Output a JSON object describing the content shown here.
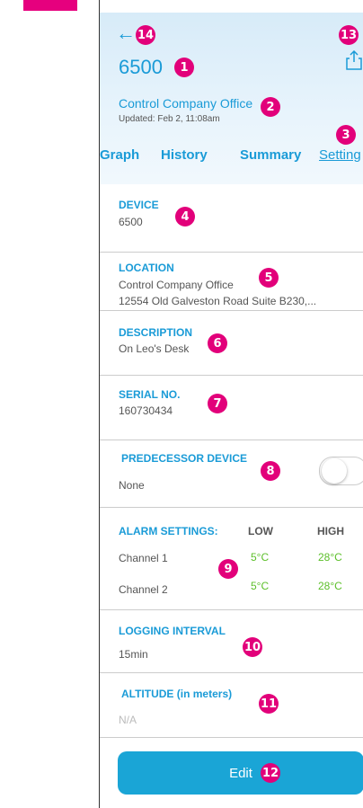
{
  "header": {
    "back_icon": "←",
    "share_icon": "share-icon",
    "device_title": "6500",
    "location_link": "Control Company Office",
    "updated": "Updated: Feb 2, 11:08am"
  },
  "tabs": [
    {
      "label": "Graph"
    },
    {
      "label": "History"
    },
    {
      "label": "Summary"
    },
    {
      "label": "Setting"
    }
  ],
  "device": {
    "label": "DEVICE",
    "value": "6500"
  },
  "location": {
    "label": "LOCATION",
    "line1": "Control Company Office",
    "line2": "12554 Old Galveston Road Suite B230,..."
  },
  "description": {
    "label": "DESCRIPTION",
    "value": "On Leo's Desk"
  },
  "serial": {
    "label": "SERIAL NO.",
    "value": "160730434"
  },
  "predecessor": {
    "label": "PREDECESSOR DEVICE",
    "value": "None",
    "toggle_on": false
  },
  "alarm": {
    "label": "ALARM SETTINGS:",
    "low_header": "LOW",
    "high_header": "HIGH",
    "channels": [
      {
        "name": "Channel 1",
        "low": "5°C",
        "high": "28°C"
      },
      {
        "name": "Channel 2",
        "low": "5°C",
        "high": "28°C"
      }
    ]
  },
  "logging": {
    "label": "LOGGING INTERVAL",
    "value": "15min"
  },
  "altitude": {
    "label": "ALTITUDE (in meters)",
    "value": "N/A"
  },
  "edit_button": "Edit",
  "badges": [
    "1",
    "2",
    "3",
    "4",
    "5",
    "6",
    "7",
    "8",
    "9",
    "10",
    "11",
    "12",
    "13",
    "14"
  ],
  "colors": {
    "accent": "#1a9bd7",
    "badge": "#e2007a",
    "green": "#5cbf2a",
    "edit": "#1aa5d6"
  }
}
